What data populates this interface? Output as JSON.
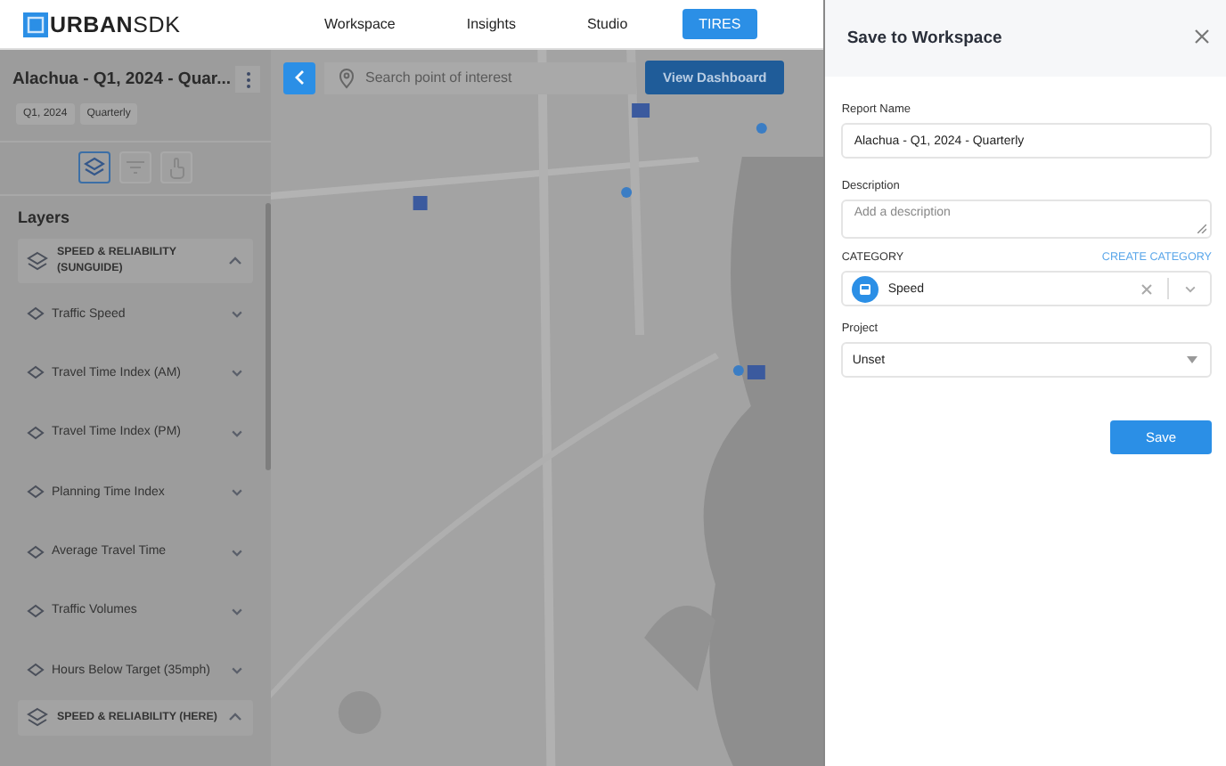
{
  "header": {
    "logo": "**URBAN**SDK",
    "nav": [
      {
        "label": "Workspace",
        "selected": false
      },
      {
        "label": "Insights",
        "selected": false
      },
      {
        "label": "Studio",
        "selected": false
      },
      {
        "label": "TIRES",
        "selected": true
      }
    ]
  },
  "report": {
    "title": "Alachua - Q1, 2024 - Quar...",
    "tags": [
      "Q1, 2024",
      "Quarterly"
    ],
    "tool_tabs": [
      {
        "kind": "layers",
        "selected": true
      },
      {
        "kind": "filter",
        "selected": false
      },
      {
        "kind": "touch",
        "selected": false
      }
    ]
  },
  "layers": {
    "title": "Layers",
    "groups": [
      {
        "label": "SPEED & RELIABILITY (SUNGUIDE)",
        "expanded": true,
        "children": [
          {
            "label": "Traffic Speed",
            "expanded": false
          },
          {
            "label": "Travel Time Index (AM)",
            "expanded": false
          },
          {
            "label": "Travel Time Index (PM)",
            "expanded": false
          },
          {
            "label": "Planning Time Index",
            "expanded": false
          },
          {
            "label": "Average Travel Time",
            "expanded": false
          },
          {
            "label": "Traffic Volumes",
            "expanded": false
          },
          {
            "label": "Hours Below Target (35mph)",
            "expanded": false
          }
        ]
      },
      {
        "label": "SPEED & RELIABILITY (HERE)",
        "expanded": true
      }
    ]
  },
  "map": {
    "search": {
      "placeholder": "Search point of interest"
    },
    "dashboard_button": "View Dashboard"
  },
  "dialog": {
    "title": "Save to Workspace",
    "report_name": {
      "label": "Report Name",
      "value": "Alachua - Q1, 2024 - Quarterly"
    },
    "description": {
      "label": "Description",
      "placeholder": "Add a description"
    },
    "category": {
      "label": "CATEGORY",
      "action": "CREATE CATEGORY",
      "value": "Speed"
    },
    "project": {
      "label": "Project",
      "value": "Unset"
    },
    "save_button": "Save"
  }
}
